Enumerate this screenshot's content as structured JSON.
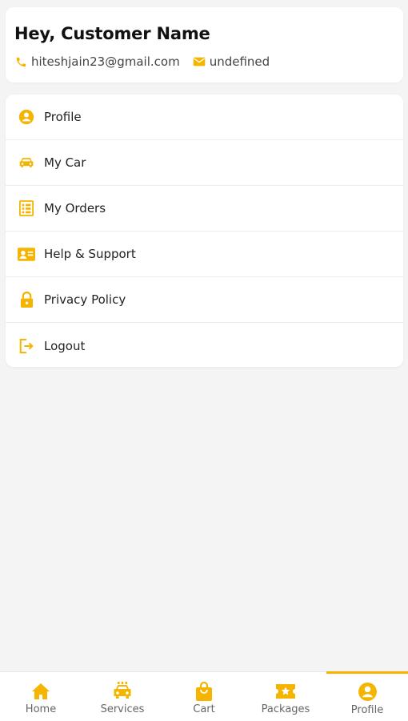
{
  "header": {
    "greeting": "Hey, Customer Name",
    "email": "hiteshjain23@gmail.com",
    "second_contact": "undefined"
  },
  "menu": {
    "items": [
      {
        "label": "Profile",
        "icon": "user-circle-icon"
      },
      {
        "label": "My Car",
        "icon": "car-icon"
      },
      {
        "label": "My Orders",
        "icon": "orders-icon"
      },
      {
        "label": "Help & Support",
        "icon": "id-card-icon"
      },
      {
        "label": "Privacy Policy",
        "icon": "lock-icon"
      },
      {
        "label": "Logout",
        "icon": "logout-icon"
      }
    ]
  },
  "bottom_nav": {
    "items": [
      {
        "label": "Home",
        "icon": "home-icon"
      },
      {
        "label": "Services",
        "icon": "taxi-icon"
      },
      {
        "label": "Cart",
        "icon": "shopping-bag-icon"
      },
      {
        "label": "Packages",
        "icon": "ticket-icon"
      },
      {
        "label": "Profile",
        "icon": "user-circle-icon"
      }
    ],
    "active": "Profile"
  },
  "colors": {
    "accent": "#f5b400",
    "background": "#f4f4f4",
    "card": "#ffffff"
  }
}
